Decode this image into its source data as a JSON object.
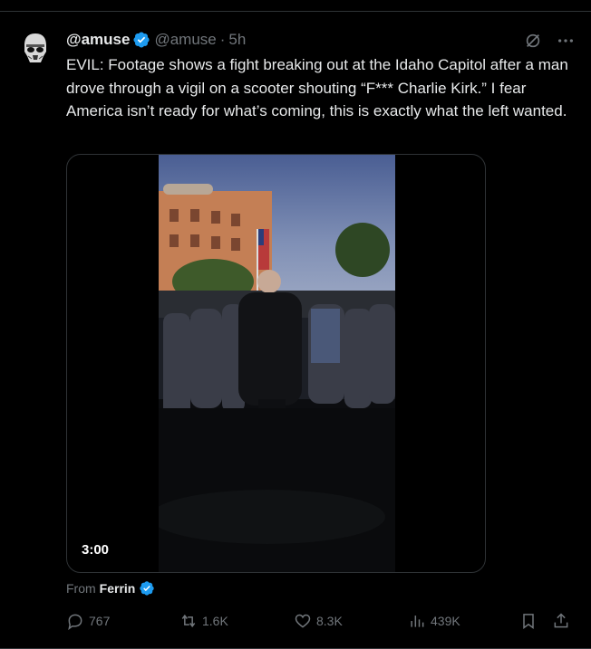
{
  "tweet": {
    "display_name": "@amuse",
    "handle": "@amuse",
    "separator": "·",
    "time": "5h",
    "text": "EVIL: Footage shows a fight breaking out at the Idaho Capitol after a man drove through a vigil on a scooter shouting “F*** Charlie Kirk.” I fear America isn’t ready for what’s coming, this is exactly what the left wanted."
  },
  "media": {
    "duration": "3:00"
  },
  "attribution": {
    "label": "From",
    "name": "Ferrin"
  },
  "metrics": {
    "replies": "767",
    "reposts": "1.6K",
    "likes": "8.3K",
    "views": "439K"
  },
  "icons": {
    "verified": "verified-badge-icon",
    "grok": "grok-icon",
    "more": "more-icon",
    "reply": "reply-icon",
    "repost": "repost-icon",
    "like": "heart-icon",
    "views": "views-icon",
    "bookmark": "bookmark-icon",
    "share": "share-icon"
  },
  "colors": {
    "background": "#000000",
    "text": "#e7e9ea",
    "secondary": "#71767b",
    "verified": "#1d9bf0",
    "border": "#2f3336"
  }
}
